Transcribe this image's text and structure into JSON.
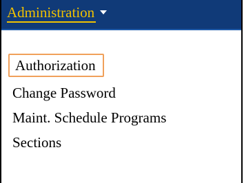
{
  "menu": {
    "title": "Administration",
    "caret_icon": "caret-down-icon",
    "title_color": "#f2c200",
    "header_color": "#103a78",
    "items": [
      {
        "label": "Authorization",
        "highlighted": true,
        "highlight_color": "#f0a05a"
      },
      {
        "label": "Change Password"
      },
      {
        "label": "Maint. Schedule Programs"
      },
      {
        "label": "Sections"
      }
    ]
  }
}
